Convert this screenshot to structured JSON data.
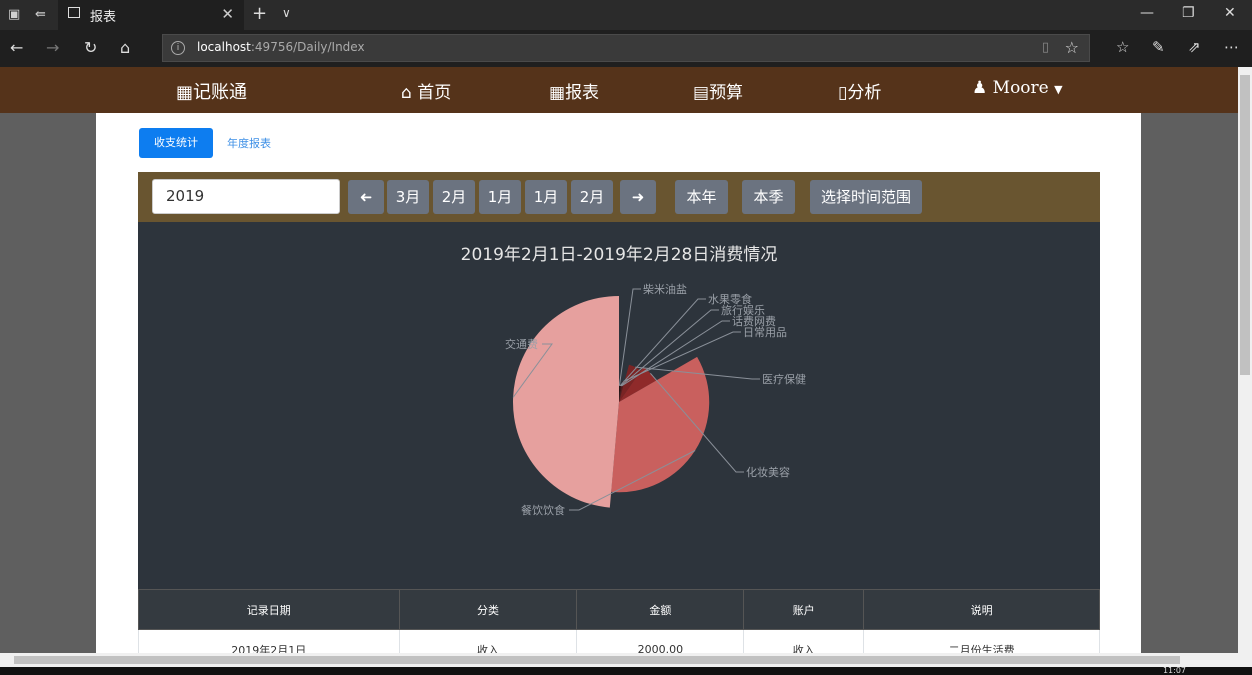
{
  "browser": {
    "tab_title": "报表",
    "url_host": "localhost",
    "url_rest": ":49756/Daily/Index"
  },
  "app_nav": {
    "brand": "记账通",
    "items": [
      "首页",
      "报表",
      "预算",
      "分析"
    ],
    "user": "Moore"
  },
  "page": {
    "tab_active": "收支统计",
    "tab_other": "年度报表",
    "year_value": "2019",
    "month_buttons": [
      "3月",
      "2月",
      "1月",
      "1月",
      "2月"
    ],
    "btn_year": "本年",
    "btn_quarter": "本季",
    "btn_range": "选择时间范围"
  },
  "chart_data": {
    "type": "pie",
    "title": "2019年2月1日-2019年2月28日消费情况",
    "rose": true,
    "slices": [
      {
        "label": "柴米油盐",
        "value": 0.5
      },
      {
        "label": "水果零食",
        "value": 0.5
      },
      {
        "label": "旅行娱乐",
        "value": 0.5
      },
      {
        "label": "话费网费",
        "value": 0.5
      },
      {
        "label": "日常用品",
        "value": 1
      },
      {
        "label": "医疗保健",
        "value": 4
      },
      {
        "label": "化妆美容",
        "value": 5
      },
      {
        "label": "餐饮饮食",
        "value": 25
      },
      {
        "label": "交通费",
        "value": 35
      }
    ],
    "colors": [
      "#1a1a1a",
      "#2a1010",
      "#3a1313",
      "#4a1818",
      "#5a1e1e",
      "#7a2424",
      "#8f2a2a",
      "#c9605e",
      "#e6a09e"
    ]
  },
  "table": {
    "headers": [
      "记录日期",
      "分类",
      "金额",
      "账户",
      "说明"
    ],
    "rows": [
      [
        "2019年2月1日",
        "收入",
        "2000.00",
        "收入",
        "二月份生活费"
      ]
    ]
  },
  "taskbar": {
    "clock": "11:07"
  }
}
